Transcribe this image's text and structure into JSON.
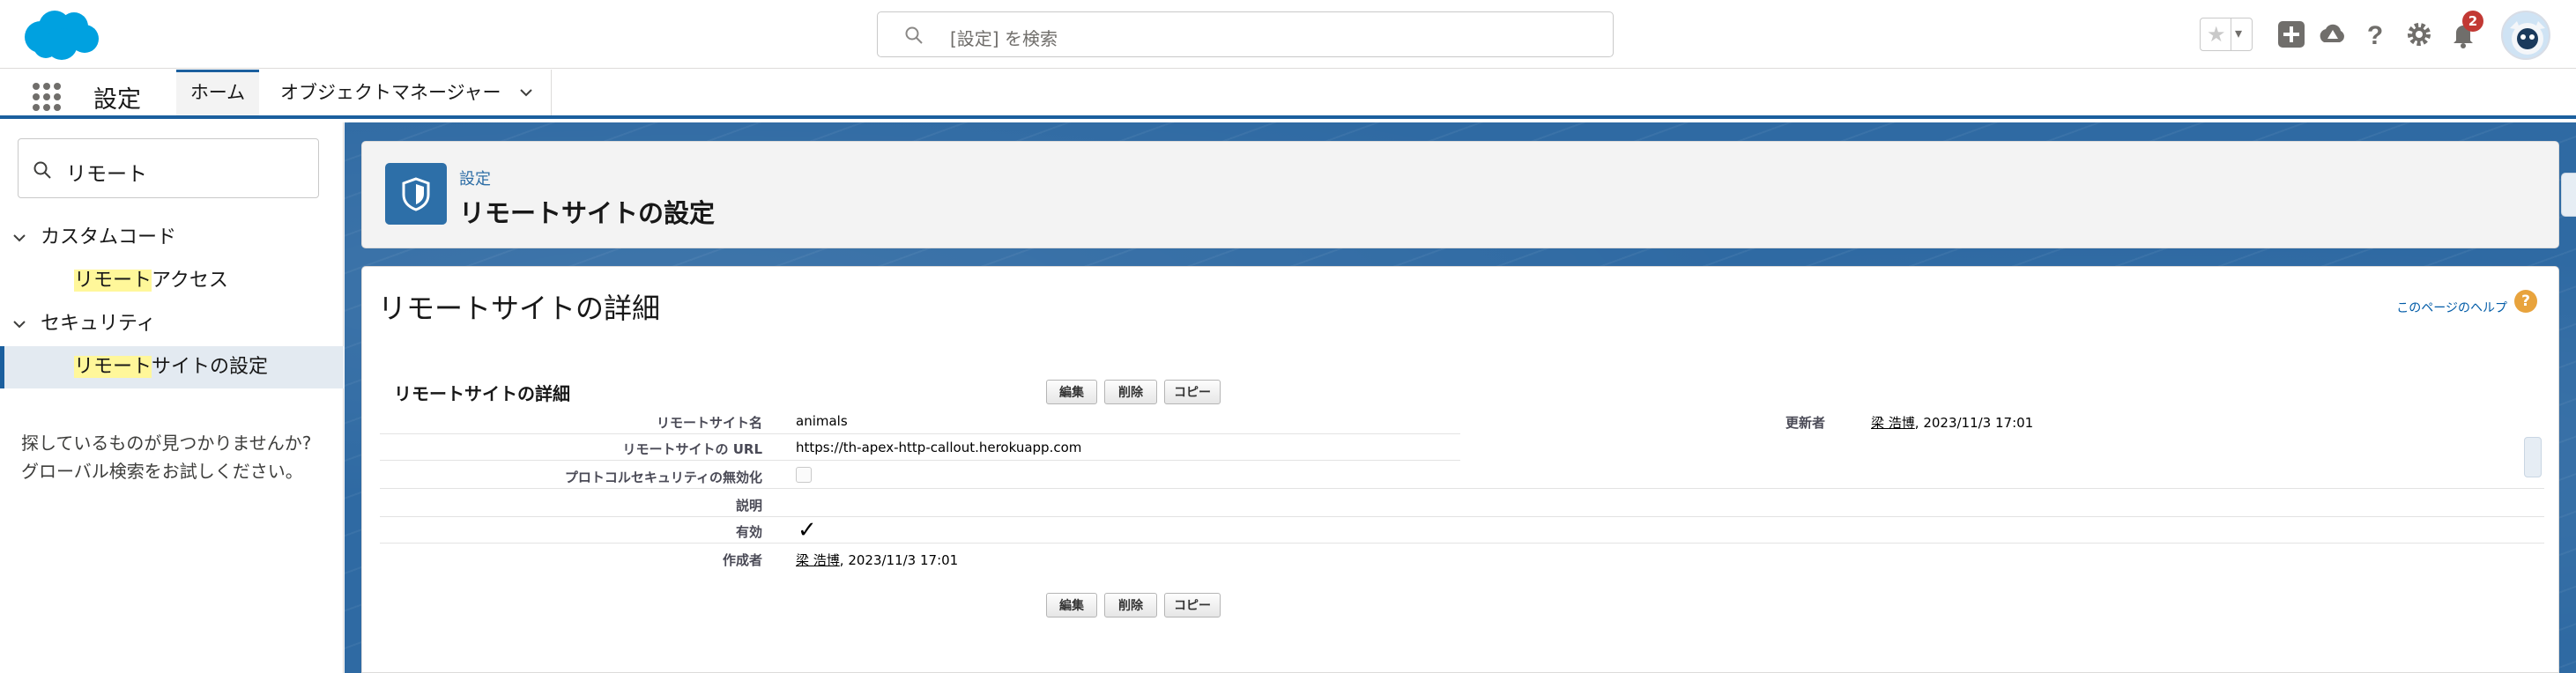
{
  "header": {
    "search_placeholder": "[設定] を検索",
    "notification_count": "2",
    "favorites_star": "★",
    "favorites_dropdown": "▾",
    "icons": [
      "salesforce-logo",
      "star-icon",
      "add-icon",
      "trailhead-icon",
      "help-icon",
      "gear-icon",
      "bell-icon",
      "avatar"
    ]
  },
  "context_bar": {
    "app_name": "設定",
    "tabs": [
      {
        "label": "ホーム",
        "active": true
      },
      {
        "label": "オブジェクトマネージャー",
        "active": false
      }
    ]
  },
  "sidebar": {
    "quick_find_value": "リモート",
    "groups": [
      {
        "label": "カスタムコード",
        "items": [
          {
            "highlight": "リモート",
            "rest": "アクセス",
            "active": false
          }
        ]
      },
      {
        "label": "セキュリティ",
        "items": [
          {
            "highlight": "リモート",
            "rest": "サイトの設定",
            "active": true
          }
        ]
      }
    ],
    "not_found_line1": "探しているものが見つかりませんか?",
    "not_found_line2": "グローバル検索をお試しください。"
  },
  "page_header": {
    "breadcrumb": "設定",
    "title": "リモートサイトの設定"
  },
  "content": {
    "title": "リモートサイトの詳細",
    "help_link": "このページのヘルプ",
    "help_icon": "?",
    "section_title": "リモートサイトの詳細",
    "buttons": {
      "edit": "編集",
      "delete": "削除",
      "copy": "コピー"
    },
    "fields": {
      "site_name_label": "リモートサイト名",
      "site_name_value": "animals",
      "url_label": "リモートサイトの URL",
      "url_value": "https://th-apex-http-callout.herokuapp.com",
      "protocol_label": "プロトコルセキュリティの無効化",
      "description_label": "説明",
      "active_label": "有効",
      "active_mark": "✓",
      "created_by_label": "作成者",
      "created_by_user": "梁 浩博",
      "created_by_date": ", 2023/11/3 17:01",
      "modified_by_label": "更新者",
      "modified_by_user": "梁 浩博",
      "modified_by_date": ", 2023/11/3 17:01"
    }
  },
  "colors": {
    "brand_blue": "#1b5f9e",
    "page_icon_blue": "#2d6fa8",
    "highlight_yellow": "#fff79a",
    "badge_red": "#c23934",
    "help_orange": "#e8a33d"
  }
}
